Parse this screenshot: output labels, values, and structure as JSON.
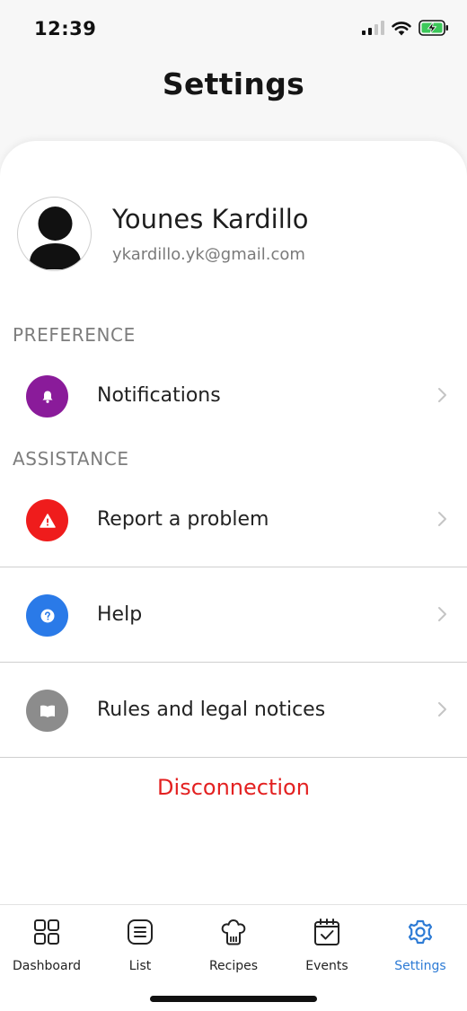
{
  "status_bar": {
    "time": "12:39"
  },
  "header": {
    "title": "Settings"
  },
  "profile": {
    "name": "Younes Kardillo",
    "email": "ykardillo.yk@gmail.com"
  },
  "sections": {
    "preference": {
      "title": "PREFERENCE",
      "items": [
        {
          "label": "Notifications",
          "icon": "bell-icon",
          "color": "#8a1b9a"
        }
      ]
    },
    "assistance": {
      "title": "ASSISTANCE",
      "items": [
        {
          "label": "Report a problem",
          "icon": "warning-icon",
          "color": "#ef1c1c"
        },
        {
          "label": "Help",
          "icon": "question-icon",
          "color": "#2a7ae8"
        },
        {
          "label": "Rules and legal notices",
          "icon": "book-icon",
          "color": "#8c8c8c"
        }
      ]
    }
  },
  "disconnect": {
    "label": "Disconnection",
    "color": "#e32121"
  },
  "tab_bar": {
    "active_color": "#2d7bd5",
    "items": [
      {
        "label": "Dashboard",
        "icon": "grid-icon"
      },
      {
        "label": "List",
        "icon": "list-icon"
      },
      {
        "label": "Recipes",
        "icon": "chef-hat-icon"
      },
      {
        "label": "Events",
        "icon": "calendar-check-icon"
      },
      {
        "label": "Settings",
        "icon": "gear-icon",
        "active": true
      }
    ]
  }
}
